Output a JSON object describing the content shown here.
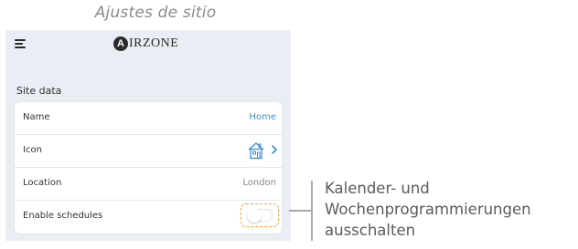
{
  "caption": "Ajustes de sitio",
  "app": {
    "logo_initial": "A",
    "logo_text": "IRZONE"
  },
  "section_title": "Site data",
  "rows": [
    {
      "label": "Name",
      "value": "Home",
      "value_color": "#3a8fd6"
    },
    {
      "label": "Icon",
      "icon": "house-icon",
      "chevron": "chevron-right-icon"
    },
    {
      "label": "Location",
      "value": "London",
      "value_color": "#8a8a8a"
    },
    {
      "label": "Enable schedules",
      "toggle_state": "off"
    }
  ],
  "callout": {
    "line1": "Kalender- und",
    "line2": "Wochenprogrammierungen",
    "line3": "ausschalten"
  },
  "colors": {
    "accent": "#3a8fd6",
    "highlight": "#f0a830",
    "screen_bg": "#e9eef4"
  }
}
